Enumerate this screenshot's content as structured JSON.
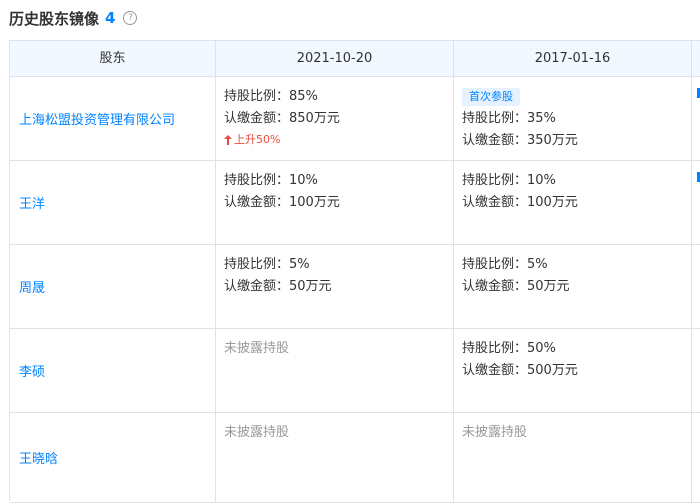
{
  "header": {
    "title": "历史股东镜像",
    "count": "4",
    "help_icon": "?"
  },
  "table": {
    "columns": [
      "股东",
      "2021-10-20",
      "2017-01-16"
    ],
    "rows": [
      {
        "holder": "上海松盟投资管理有限公司",
        "d1": {
          "ratio": "持股比例：85%",
          "amount": "认缴金额：850万元",
          "change": "上升50%"
        },
        "d2": {
          "tag": "首次参股",
          "ratio": "持股比例：35%",
          "amount": "认缴金额：350万元"
        }
      },
      {
        "holder": "王洋",
        "d1": {
          "ratio": "持股比例：10%",
          "amount": "认缴金额：100万元"
        },
        "d2": {
          "ratio": "持股比例：10%",
          "amount": "认缴金额：100万元"
        }
      },
      {
        "holder": "周晟",
        "d1": {
          "ratio": "持股比例：5%",
          "amount": "认缴金额：50万元"
        },
        "d2": {
          "ratio": "持股比例：5%",
          "amount": "认缴金额：50万元"
        }
      },
      {
        "holder": "李硕",
        "d1": {
          "undisclosed": "未披露持股"
        },
        "d2": {
          "ratio": "持股比例：50%",
          "amount": "认缴金额：500万元"
        }
      },
      {
        "holder": "王晓晗",
        "d1": {
          "undisclosed": "未披露持股"
        },
        "d2": {
          "undisclosed": "未披露持股"
        }
      }
    ]
  },
  "colors": {
    "accent": "#0084ff",
    "up": "#e84c3d",
    "header_bg": "#f2f8ff",
    "border": "#dde3ec"
  }
}
